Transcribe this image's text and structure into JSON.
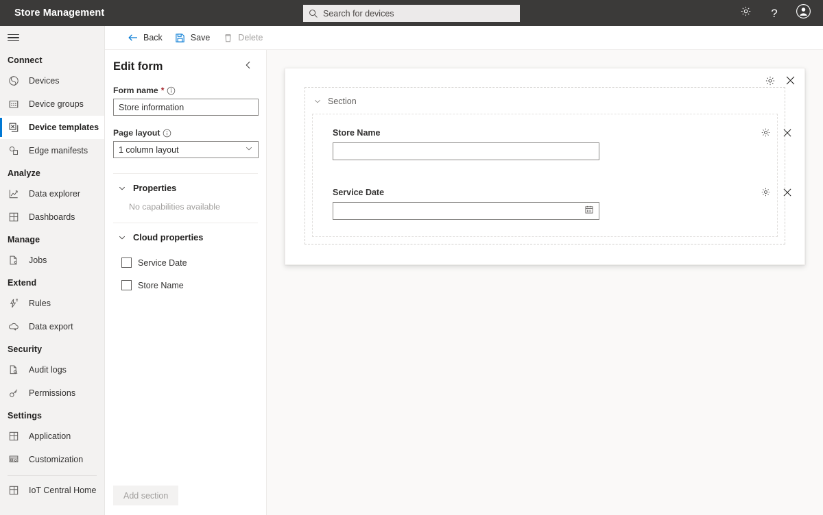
{
  "header": {
    "app_title": "Store Management",
    "search": {
      "placeholder": "Search for devices",
      "icon": "search-icon"
    },
    "settings_icon": "gear-icon",
    "help_icon": "help-question-icon",
    "help_glyph": "?",
    "account_icon": "account-avatar-icon"
  },
  "sidebar": {
    "menu_icon": "hamburger-menu-icon",
    "groups": [
      {
        "label": "Connect",
        "items": [
          {
            "label": "Devices",
            "icon": "devices-icon",
            "selected": false
          },
          {
            "label": "Device groups",
            "icon": "device-groups-icon",
            "selected": false
          },
          {
            "label": "Device templates",
            "icon": "device-templates-icon",
            "selected": true
          },
          {
            "label": "Edge manifests",
            "icon": "edge-manifests-icon",
            "selected": false
          }
        ]
      },
      {
        "label": "Analyze",
        "items": [
          {
            "label": "Data explorer",
            "icon": "data-explorer-icon",
            "selected": false
          },
          {
            "label": "Dashboards",
            "icon": "dashboards-icon",
            "selected": false
          }
        ]
      },
      {
        "label": "Manage",
        "items": [
          {
            "label": "Jobs",
            "icon": "jobs-icon",
            "selected": false
          }
        ]
      },
      {
        "label": "Extend",
        "items": [
          {
            "label": "Rules",
            "icon": "rules-icon",
            "selected": false
          },
          {
            "label": "Data export",
            "icon": "data-export-icon",
            "selected": false
          }
        ]
      },
      {
        "label": "Security",
        "items": [
          {
            "label": "Audit logs",
            "icon": "audit-logs-icon",
            "selected": false
          },
          {
            "label": "Permissions",
            "icon": "permissions-key-icon",
            "selected": false
          }
        ]
      },
      {
        "label": "Settings",
        "items": [
          {
            "label": "Application",
            "icon": "application-icon",
            "selected": false
          },
          {
            "label": "Customization",
            "icon": "customization-icon",
            "selected": false
          }
        ]
      }
    ],
    "footer_item": {
      "label": "IoT Central Home",
      "icon": "iot-central-home-icon"
    }
  },
  "toolbar": {
    "back_label": "Back",
    "back_icon": "arrow-left-icon",
    "save_label": "Save",
    "save_icon": "save-disk-icon",
    "delete_label": "Delete",
    "delete_icon": "trash-icon",
    "delete_disabled": true
  },
  "edit_panel": {
    "title": "Edit form",
    "collapse_icon": "chevron-left-icon",
    "form_name": {
      "label": "Form name",
      "required_marker": "*",
      "info_icon": "info-circle-icon",
      "value": "Store information"
    },
    "page_layout": {
      "label": "Page layout",
      "info_icon": "info-circle-icon",
      "value": "1 column layout",
      "chevron_icon": "chevron-down-icon",
      "options": [
        "1 column layout"
      ]
    },
    "accordions": [
      {
        "title": "Properties",
        "chevron_icon": "chevron-down-icon",
        "empty_text": "No capabilities available",
        "items": []
      },
      {
        "title": "Cloud properties",
        "chevron_icon": "chevron-down-icon",
        "empty_text": "",
        "items": [
          {
            "label": "Service Date",
            "checked": false
          },
          {
            "label": "Store Name",
            "checked": false
          }
        ]
      }
    ],
    "add_section_label": "Add section",
    "add_section_disabled": true
  },
  "canvas": {
    "section": {
      "name": "Section",
      "chevron_icon": "chevron-down-icon",
      "settings_icon": "gear-icon",
      "close_icon": "close-x-icon"
    },
    "fields": [
      {
        "label": "Store Name",
        "value": "",
        "type": "text",
        "trailing_icon": "",
        "settings_icon": "gear-icon",
        "close_icon": "close-x-icon"
      },
      {
        "label": "Service Date",
        "value": "",
        "type": "date",
        "trailing_icon": "calendar-icon",
        "settings_icon": "gear-icon",
        "close_icon": "close-x-icon"
      }
    ]
  },
  "colors": {
    "header_bg": "#3b3a39",
    "accent": "#0078d4",
    "required": "#a4262c",
    "sidebar_bg": "#f3f2f1",
    "canvas_bg": "#faf9f8"
  }
}
